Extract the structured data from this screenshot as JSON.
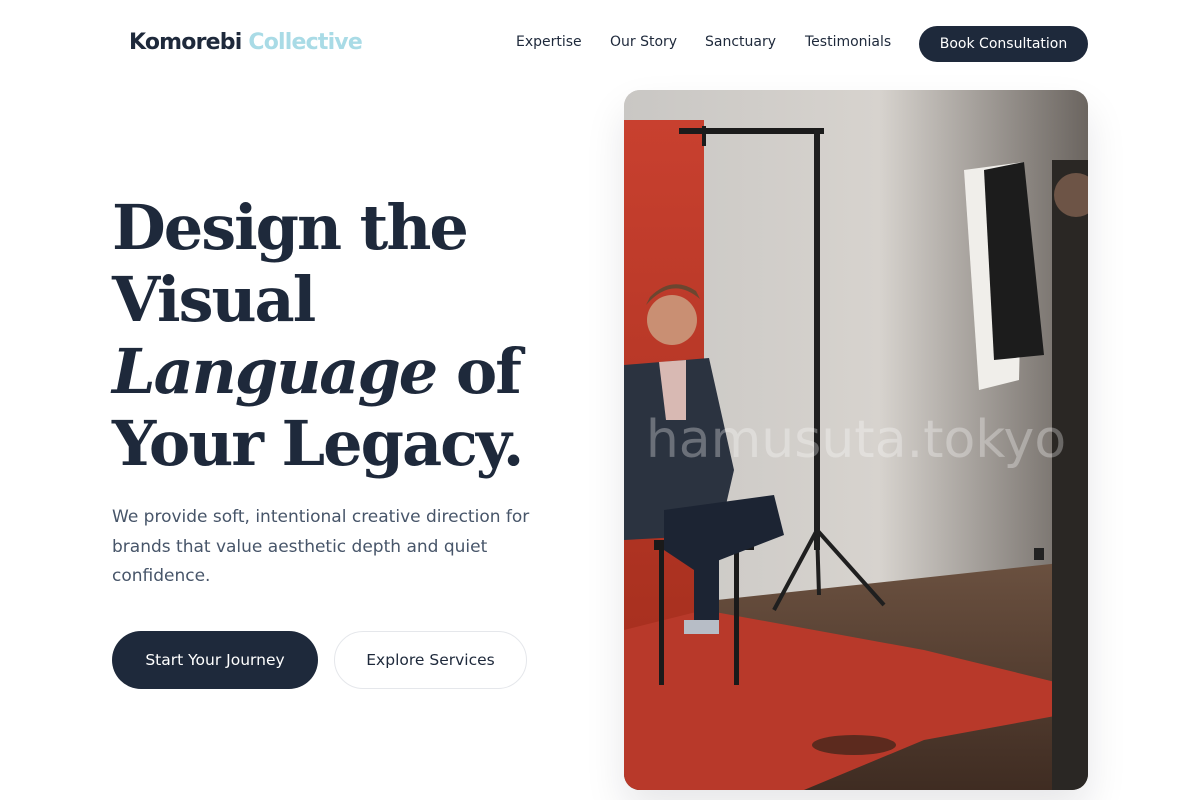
{
  "brand": {
    "name_primary": "Komorebi",
    "name_accent": "Collective"
  },
  "nav": {
    "links": [
      "Expertise",
      "Our Story",
      "Sanctuary",
      "Testimonials"
    ],
    "cta": "Book Consultation"
  },
  "hero": {
    "title_line1": "Design the",
    "title_line2": "Visual",
    "title_line3_italic": "Language",
    "title_line3_rest": " of",
    "title_line4": "Your Legacy.",
    "description": "We provide soft, intentional creative direction for brands that value aesthetic depth and quiet confidence.",
    "primary_cta": "Start Your Journey",
    "secondary_cta": "Explore Services"
  },
  "image": {
    "watermark": "hamusuta.tokyo"
  },
  "colors": {
    "brand_dark": "#1e293b",
    "brand_accent": "#a9dbe6",
    "text_muted": "#475569",
    "backdrop_red": "#c0392b"
  }
}
